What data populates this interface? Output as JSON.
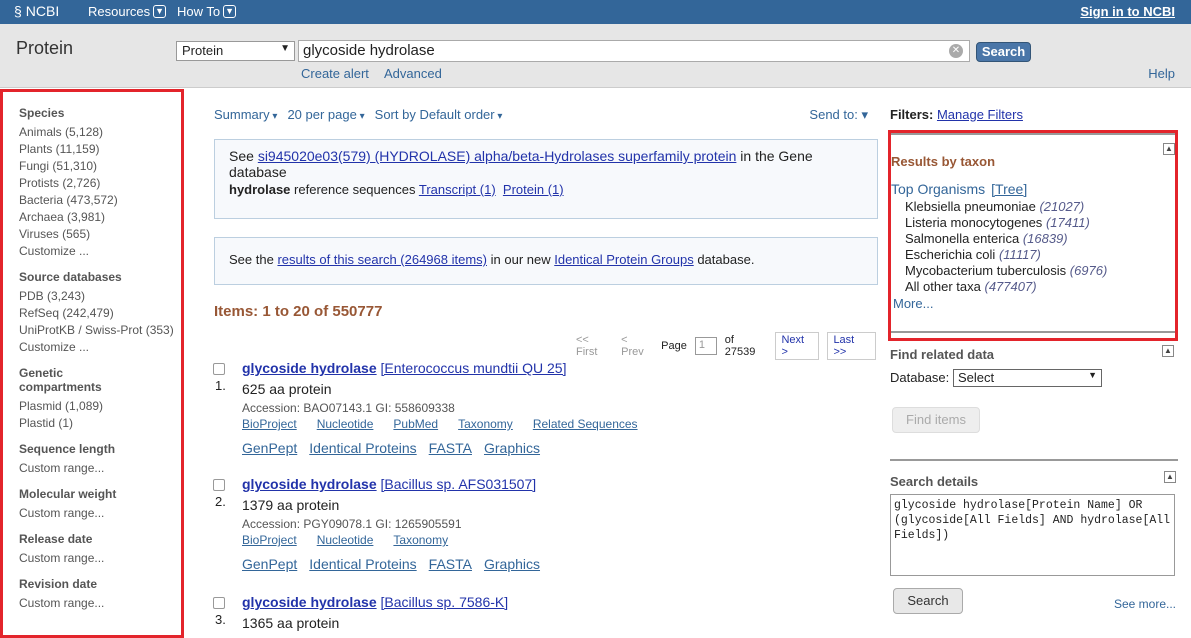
{
  "topbar": {
    "logo": "NCBI",
    "resources": "Resources",
    "howto": "How To",
    "signin": "Sign in to NCBI"
  },
  "search": {
    "db_title": "Protein",
    "db_selected": "Protein",
    "term": "glycoside hydrolase",
    "button": "Search",
    "create_alert": "Create alert",
    "advanced": "Advanced",
    "help": "Help"
  },
  "sidebar": {
    "groups": [
      {
        "heading": "Species",
        "items": [
          "Animals (5,128)",
          "Plants (11,159)",
          "Fungi (51,310)",
          "Protists (2,726)",
          "Bacteria (473,572)",
          "Archaea (3,981)",
          "Viruses (565)",
          "Customize ..."
        ]
      },
      {
        "heading": "Source databases",
        "items": [
          "PDB (3,243)",
          "RefSeq (242,479)",
          "UniProtKB / Swiss-Prot (353)",
          "Customize ..."
        ]
      },
      {
        "heading": "Genetic compartments",
        "items": [
          "Plasmid (1,089)",
          "Plastid (1)"
        ]
      },
      {
        "heading": "Sequence length",
        "items": [
          "Custom range..."
        ]
      },
      {
        "heading": "Molecular weight",
        "items": [
          "Custom range..."
        ]
      },
      {
        "heading": "Release date",
        "items": [
          "Custom range..."
        ]
      },
      {
        "heading": "Revision date",
        "items": [
          "Custom range..."
        ]
      }
    ]
  },
  "toolbar": {
    "summary": "Summary",
    "perpage": "20 per page",
    "sort": "Sort by Default order",
    "sendto": "Send to:"
  },
  "gene_box": {
    "see": "See",
    "link": "si945020e03(579) (HYDROLASE) alpha/beta-Hydrolases superfamily protein",
    "tail": "in the Gene database",
    "refseq_bold": "hydrolase",
    "refseq_text": "reference sequences",
    "transcript": "Transcript (1)",
    "protein": "Protein (1)"
  },
  "ipg_box": {
    "see": "See the",
    "link1": "results of this search (264968 items)",
    "mid": "in our new",
    "link2": "Identical Protein Groups",
    "tail": "database."
  },
  "items_summary": "Items: 1 to 20 of 550777",
  "pager": {
    "first": "<< First",
    "prev": "< Prev",
    "page_label": "Page",
    "page": "1",
    "of": "of 27539",
    "next": "Next >",
    "last": "Last >>"
  },
  "results": [
    {
      "num": "1.",
      "title_bold": "glycoside hydrolase",
      "title_rest": "[Enterococcus mundtii QU 25]",
      "desc": "625 aa protein",
      "accession": "Accession: BAO07143.1   GI: 558609338",
      "links1": [
        "BioProject",
        "Nucleotide",
        "PubMed",
        "Taxonomy",
        "Related Sequences"
      ],
      "links2": [
        "GenPept",
        "Identical Proteins",
        "FASTA",
        "Graphics"
      ]
    },
    {
      "num": "2.",
      "title_bold": "glycoside hydrolase",
      "title_rest": "[Bacillus sp. AFS031507]",
      "desc": "1379 aa protein",
      "accession": "Accession: PGY09078.1   GI: 1265905591",
      "links1": [
        "BioProject",
        "Nucleotide",
        "Taxonomy"
      ],
      "links2": [
        "GenPept",
        "Identical Proteins",
        "FASTA",
        "Graphics"
      ]
    },
    {
      "num": "3.",
      "title_bold": "glycoside hydrolase",
      "title_rest": "[Bacillus sp. 7586-K]",
      "desc": "1365 aa protein",
      "accession": "",
      "links1": [],
      "links2": []
    }
  ],
  "right": {
    "filters_label": "Filters:",
    "manage_filters": "Manage Filters",
    "taxon_heading": "Results by taxon",
    "top_organisms": "Top Organisms",
    "tree": "[Tree]",
    "organisms": [
      {
        "name": "Klebsiella pneumoniae",
        "count": "(21027)"
      },
      {
        "name": "Listeria monocytogenes",
        "count": "(17411)"
      },
      {
        "name": "Salmonella enterica",
        "count": "(16839)"
      },
      {
        "name": "Escherichia coli",
        "count": "(11117)"
      },
      {
        "name": "Mycobacterium tuberculosis",
        "count": "(6976)"
      },
      {
        "name": "All other taxa",
        "count": "(477407)"
      }
    ],
    "more": "More...",
    "related_heading": "Find related data",
    "database_label": "Database:",
    "database_selected": "Select",
    "find_items": "Find items",
    "details_heading": "Search details",
    "query": "glycoside hydrolase[Protein Name] OR (glycoside[All Fields] AND hydrolase[All Fields])",
    "search_button": "Search",
    "see_more": "See more..."
  }
}
